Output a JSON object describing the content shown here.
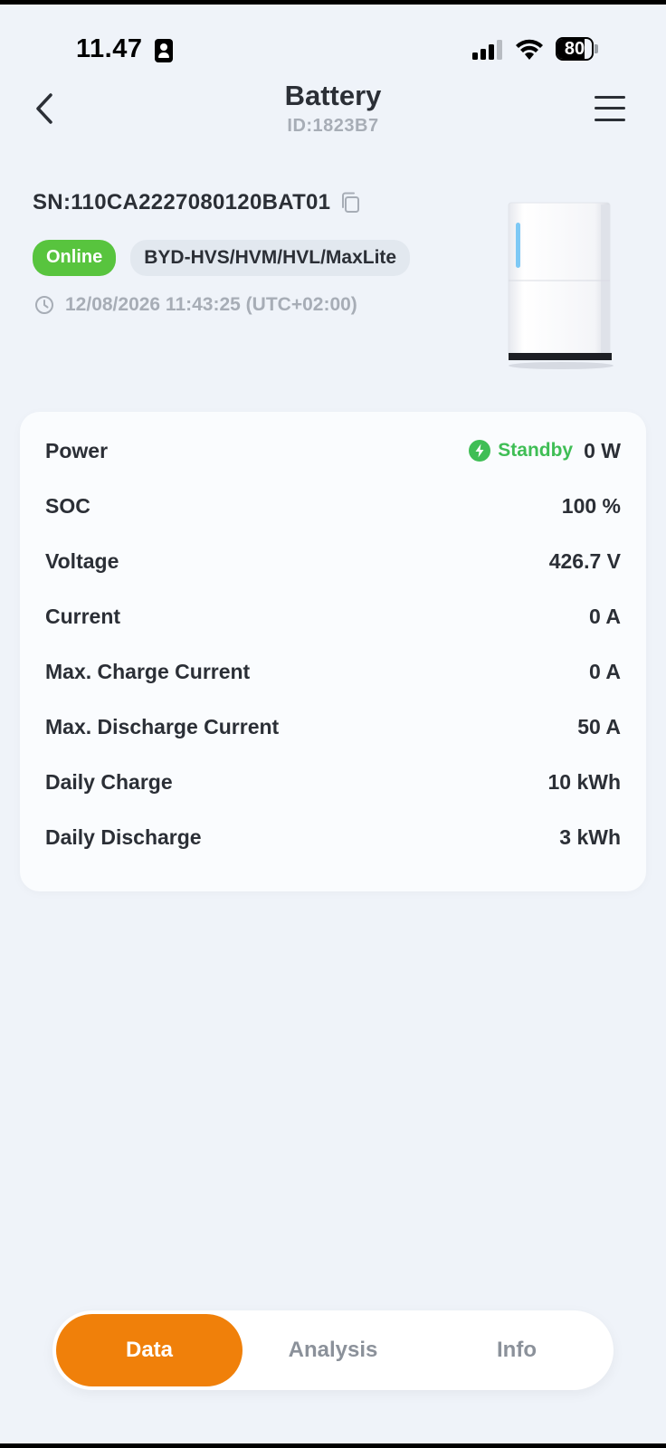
{
  "status_bar": {
    "time": "11.47",
    "battery_percent": "80",
    "battery_level": 0.8
  },
  "header": {
    "title": "Battery",
    "subtitle": "ID:1823B7"
  },
  "device": {
    "serial_number": "SN:110CA2227080120BAT01",
    "status_tag": "Online",
    "model_tag": "BYD-HVS/HVM/HVL/MaxLite",
    "timestamp": "12/08/2026 11:43:25 (UTC+02:00)"
  },
  "data_card": {
    "rows": [
      {
        "label": "Power",
        "status": "Standby",
        "value": "0 W"
      },
      {
        "label": "SOC",
        "value": "100 %"
      },
      {
        "label": "Voltage",
        "value": "426.7 V"
      },
      {
        "label": "Current",
        "value": "0 A"
      },
      {
        "label": "Max. Charge Current",
        "value": "0 A"
      },
      {
        "label": "Max. Discharge Current",
        "value": "50 A"
      },
      {
        "label": "Daily Charge",
        "value": "10 kWh"
      },
      {
        "label": "Daily Discharge",
        "value": "3 kWh"
      }
    ]
  },
  "tabs": [
    {
      "label": "Data",
      "active": true
    },
    {
      "label": "Analysis",
      "active": false
    },
    {
      "label": "Info",
      "active": false
    }
  ],
  "colors": {
    "accent": "#f0800a",
    "online": "#58c43e",
    "standby": "#3fbe55",
    "background": "#eff3f9"
  }
}
